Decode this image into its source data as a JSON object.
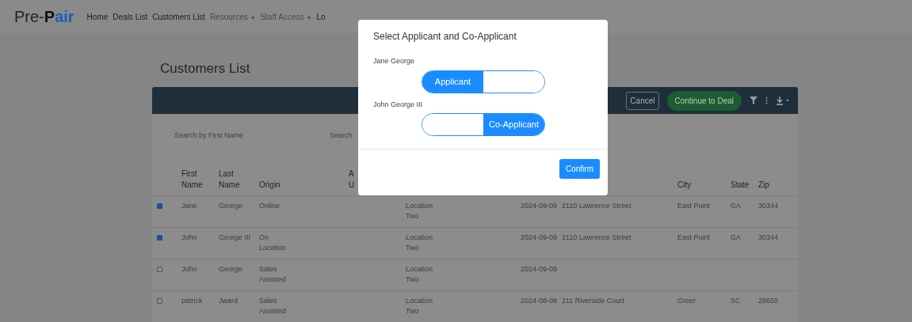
{
  "nav": {
    "logo": {
      "plain": "Pre-",
      "bold": "P",
      "accent": "air"
    },
    "items": [
      {
        "label": "Home",
        "disabled": false
      },
      {
        "label": "Deals List",
        "disabled": false
      },
      {
        "label": "Customers List",
        "disabled": false
      },
      {
        "label": "Resources",
        "disabled": true,
        "caret": "▼"
      },
      {
        "label": "Staff Access",
        "disabled": true,
        "caret": "▼"
      },
      {
        "label": "Lo",
        "disabled": false
      }
    ]
  },
  "page_title": "Customers List",
  "toolbar": {
    "cancel": "Cancel",
    "continue": "Continue to Deal"
  },
  "search": [
    {
      "placeholder": "Search by First Name"
    },
    {
      "placeholder": "Search"
    }
  ],
  "table": {
    "columns": [
      {
        "label": "First Name"
      },
      {
        "label": "Last Name"
      },
      {
        "label": "Origin"
      },
      {
        "label": "A U"
      },
      {
        "label": "City"
      },
      {
        "label": "State"
      },
      {
        "label": "Zip"
      }
    ],
    "rows": [
      {
        "checked": true,
        "first_name": "Jane",
        "last_name": "George",
        "origin": "Online",
        "location": "Location Two",
        "date": "2024-09-09",
        "address": "2110 Lawrence Street",
        "city": "East Point",
        "state": "GA",
        "zip": "30344"
      },
      {
        "checked": true,
        "first_name": "John",
        "last_name": "George III",
        "origin": "On Location",
        "location": "Location Two",
        "date": "2024-09-09",
        "address": "2110 Lawrence Street",
        "city": "East Point",
        "state": "GA",
        "zip": "30344"
      },
      {
        "checked": false,
        "first_name": "John",
        "last_name": "George",
        "origin": "Sales Assisted",
        "location": "Location Two",
        "date": "2024-09-09"
      },
      {
        "checked": false,
        "first_name": "patrick",
        "last_name": "Jward",
        "origin": "Sales Assisted",
        "location": "Location Two",
        "date": "2024-08-08",
        "address": "211 Riverside Court",
        "city": "Greer",
        "state": "SC",
        "zip": "29650"
      }
    ]
  },
  "dialog": {
    "title": "Select Applicant and Co-Applicant",
    "people": [
      {
        "name": "Jane George",
        "segments": [
          {
            "label": "Applicant",
            "selected": true
          },
          {
            "selected": false
          }
        ]
      },
      {
        "name": "John George III",
        "segments": [
          {
            "selected": false
          },
          {
            "label": "Co-Applicant",
            "selected": true
          }
        ]
      }
    ],
    "confirm": "Confirm"
  }
}
